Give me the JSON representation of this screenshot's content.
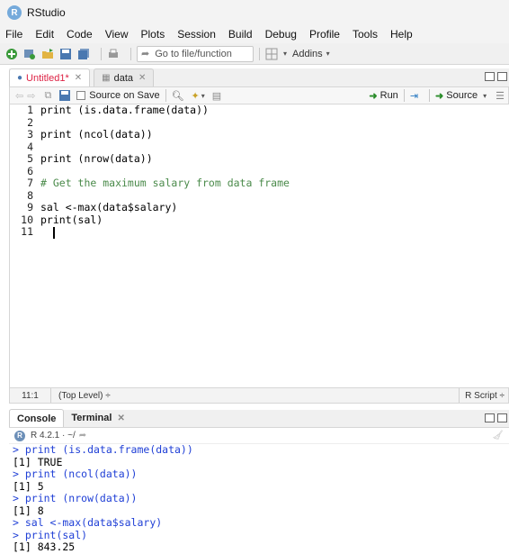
{
  "window": {
    "title": "RStudio"
  },
  "menu": [
    "File",
    "Edit",
    "Code",
    "View",
    "Plots",
    "Session",
    "Build",
    "Debug",
    "Profile",
    "Tools",
    "Help"
  ],
  "toolbar": {
    "goto_placeholder": "Go to file/function",
    "addins_label": "Addins"
  },
  "editor": {
    "tabs": [
      {
        "label": "Untitled1*",
        "active": true
      },
      {
        "label": "data",
        "active": false
      }
    ],
    "source_on_save_label": "Source on Save",
    "run_label": "Run",
    "source_label": "Source",
    "lines": [
      {
        "n": "1",
        "text": "print (is.data.frame(data))"
      },
      {
        "n": "2",
        "text": ""
      },
      {
        "n": "3",
        "text": "print (ncol(data))"
      },
      {
        "n": "4",
        "text": ""
      },
      {
        "n": "5",
        "text": "print (nrow(data))"
      },
      {
        "n": "6",
        "text": ""
      },
      {
        "n": "7",
        "text": "# Get the maximum salary from data frame"
      },
      {
        "n": "8",
        "text": ""
      },
      {
        "n": "9",
        "text": "sal <-max(data$salary)"
      },
      {
        "n": "10",
        "text": "print(sal)"
      },
      {
        "n": "11",
        "text": ""
      }
    ],
    "status": {
      "position": "11:1",
      "scope": "(Top Level) ÷",
      "file_type": "R Script ÷"
    }
  },
  "console_panel": {
    "tabs": [
      {
        "label": "Console",
        "active": true
      },
      {
        "label": "Terminal",
        "active": false
      }
    ],
    "r_version": "R 4.2.1 · ~/",
    "lines": [
      {
        "kind": "cmd",
        "text": "> print (is.data.frame(data))"
      },
      {
        "kind": "out",
        "text": "[1] TRUE"
      },
      {
        "kind": "cmd",
        "text": "> print (ncol(data))"
      },
      {
        "kind": "out",
        "text": "[1] 5"
      },
      {
        "kind": "cmd",
        "text": "> print (nrow(data))"
      },
      {
        "kind": "out",
        "text": "[1] 8"
      },
      {
        "kind": "cmd",
        "text": "> sal <-max(data$salary)"
      },
      {
        "kind": "cmd",
        "text": "> print(sal)"
      },
      {
        "kind": "out",
        "text": "[1] 843.25"
      }
    ]
  }
}
